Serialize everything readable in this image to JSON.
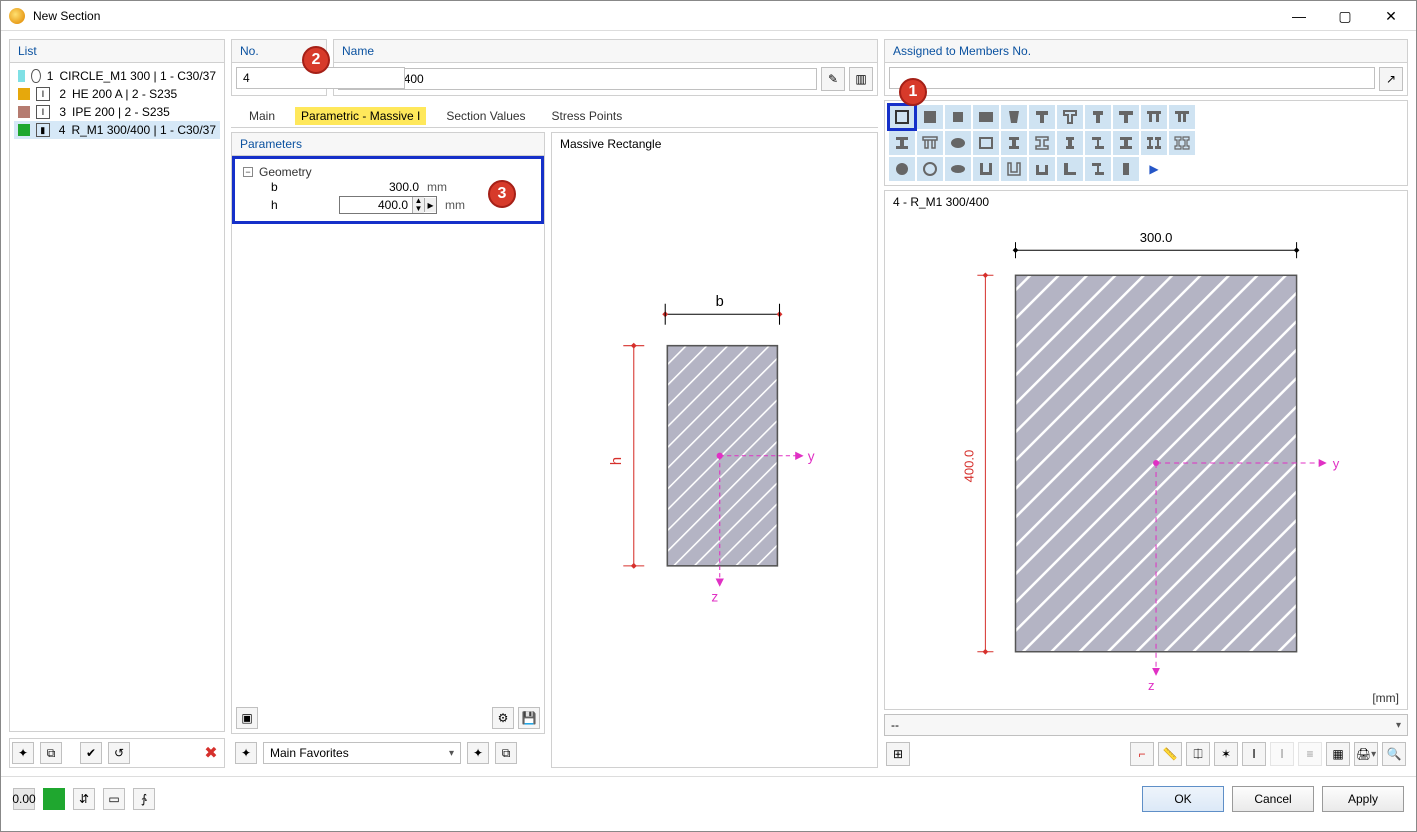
{
  "window": {
    "title": "New Section"
  },
  "panels": {
    "list_title": "List",
    "no_title": "No.",
    "name_title": "Name",
    "assigned_title": "Assigned to Members No.",
    "parameters_title": "Parameters",
    "preview_title": "Massive Rectangle"
  },
  "fields": {
    "no_value": "4",
    "name_value": "R_M1 300/400"
  },
  "tabs": {
    "main": "Main",
    "parametric": "Parametric - Massive I",
    "section_values": "Section Values",
    "stress_points": "Stress Points"
  },
  "list": {
    "items": [
      {
        "num": "1",
        "label": "CIRCLE_M1 300 | 1 - C30/37",
        "color": "#7fe0e5"
      },
      {
        "num": "2",
        "label": "HE 200 A | 2 - S235",
        "color": "#e6a80c"
      },
      {
        "num": "3",
        "label": "IPE 200 | 2 - S235",
        "color": "#b57b70"
      },
      {
        "num": "4",
        "label": "R_M1 300/400 | 1 - C30/37",
        "color": "#1fa72f"
      }
    ]
  },
  "geometry": {
    "group_title": "Geometry",
    "b_label": "b",
    "b_value": "300.0",
    "h_label": "h",
    "h_value": "400.0",
    "unit": "mm"
  },
  "shape_dims": {
    "b_label": "b",
    "h_label": "h",
    "y_label": "y",
    "z_label": "z"
  },
  "big_preview": {
    "title_label": "4 - R_M1 300/400",
    "width_label": "300.0",
    "height_label": "400.0",
    "y_label": "y",
    "z_label": "z",
    "unit_label": "[mm]"
  },
  "status": {
    "dash": "--"
  },
  "favorites": {
    "label": "Main Favorites"
  },
  "callouts": {
    "c1": "1",
    "c2": "2",
    "c3": "3"
  },
  "footer": {
    "ok": "OK",
    "cancel": "Cancel",
    "apply": "Apply"
  }
}
